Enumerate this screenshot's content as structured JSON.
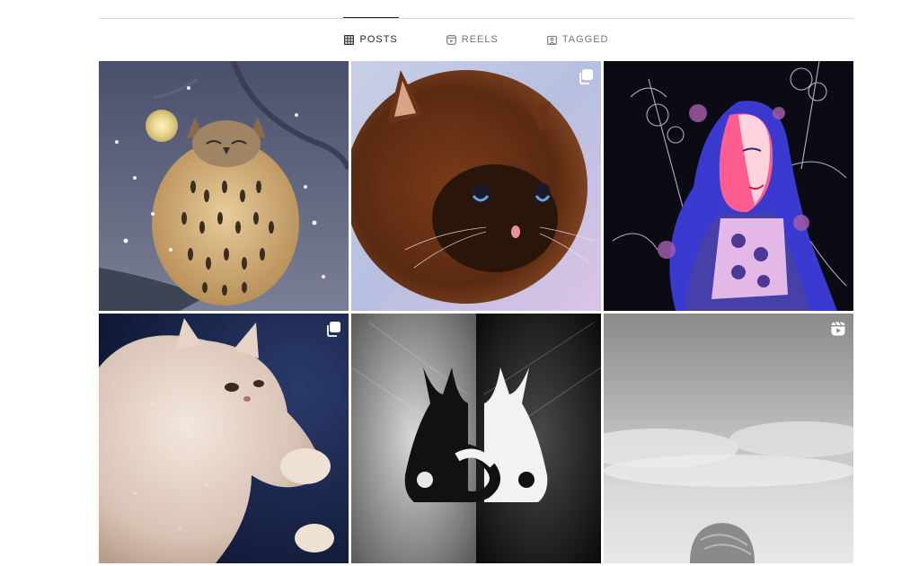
{
  "tabs": [
    {
      "label": "POSTS",
      "icon": "grid-icon",
      "active": true
    },
    {
      "label": "REELS",
      "icon": "reels-icon",
      "active": false
    },
    {
      "label": "TAGGED",
      "icon": "tagged-icon",
      "active": false
    }
  ],
  "posts": [
    {
      "subject": "owl",
      "badge": null
    },
    {
      "subject": "brown-cat",
      "badge": "carousel-icon"
    },
    {
      "subject": "woman-portrait",
      "badge": null
    },
    {
      "subject": "white-cat",
      "badge": "carousel-icon"
    },
    {
      "subject": "two-cats",
      "badge": null
    },
    {
      "subject": "grey-landscape",
      "badge": "reel-icon"
    }
  ],
  "colors": {
    "active_tab": "#262626",
    "inactive_tab": "#737373",
    "divider": "#dbdbdb"
  }
}
